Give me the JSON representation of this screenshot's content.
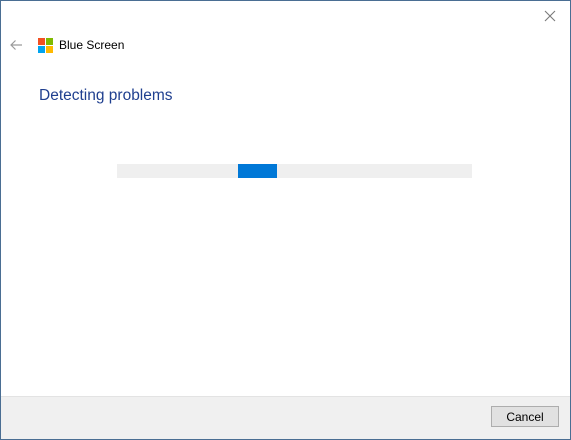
{
  "window": {
    "close_icon": "close-icon",
    "back_icon": "back-arrow-icon"
  },
  "header": {
    "app_icon": "windows-logo-icon",
    "app_title": "Blue Screen",
    "logo_colors": [
      "#f25022",
      "#7fba00",
      "#00a4ef",
      "#ffb900"
    ]
  },
  "main": {
    "title": "Detecting problems",
    "progress": {
      "mode": "indeterminate",
      "color": "#0078d7",
      "track_color": "#efefef"
    }
  },
  "footer": {
    "cancel_label": "Cancel"
  },
  "colors": {
    "title": "#1f3f8f",
    "accent": "#0078d7"
  }
}
